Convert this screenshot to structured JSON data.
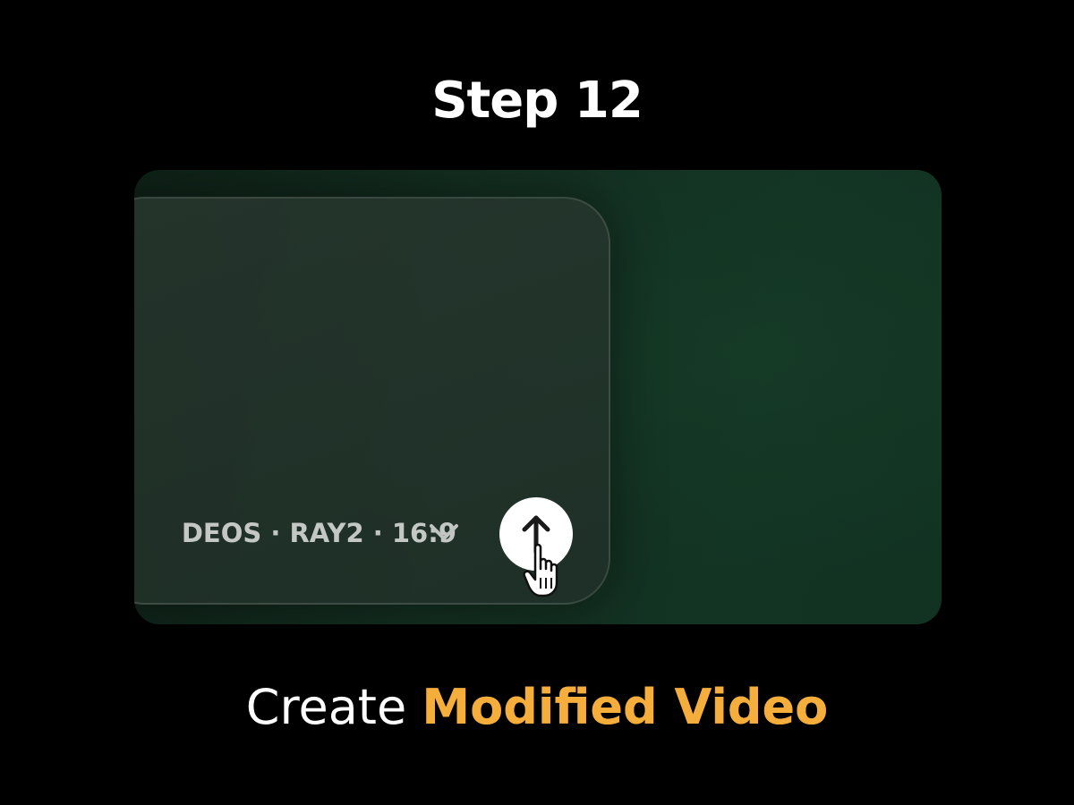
{
  "step": {
    "title": "Step 12"
  },
  "screenshot": {
    "options_text": "DEOS · RAY2 · 16:9",
    "submit_icon": "arrow-up-icon",
    "dropdown_icon": "chevron-down-icon",
    "cursor_icon": "hand-pointer-icon"
  },
  "caption": {
    "plain": "Create",
    "accent": "Modified Video"
  },
  "colors": {
    "background": "#000000",
    "panel": "#133423",
    "accent": "#f5ad3c",
    "title": "#ffffff"
  }
}
